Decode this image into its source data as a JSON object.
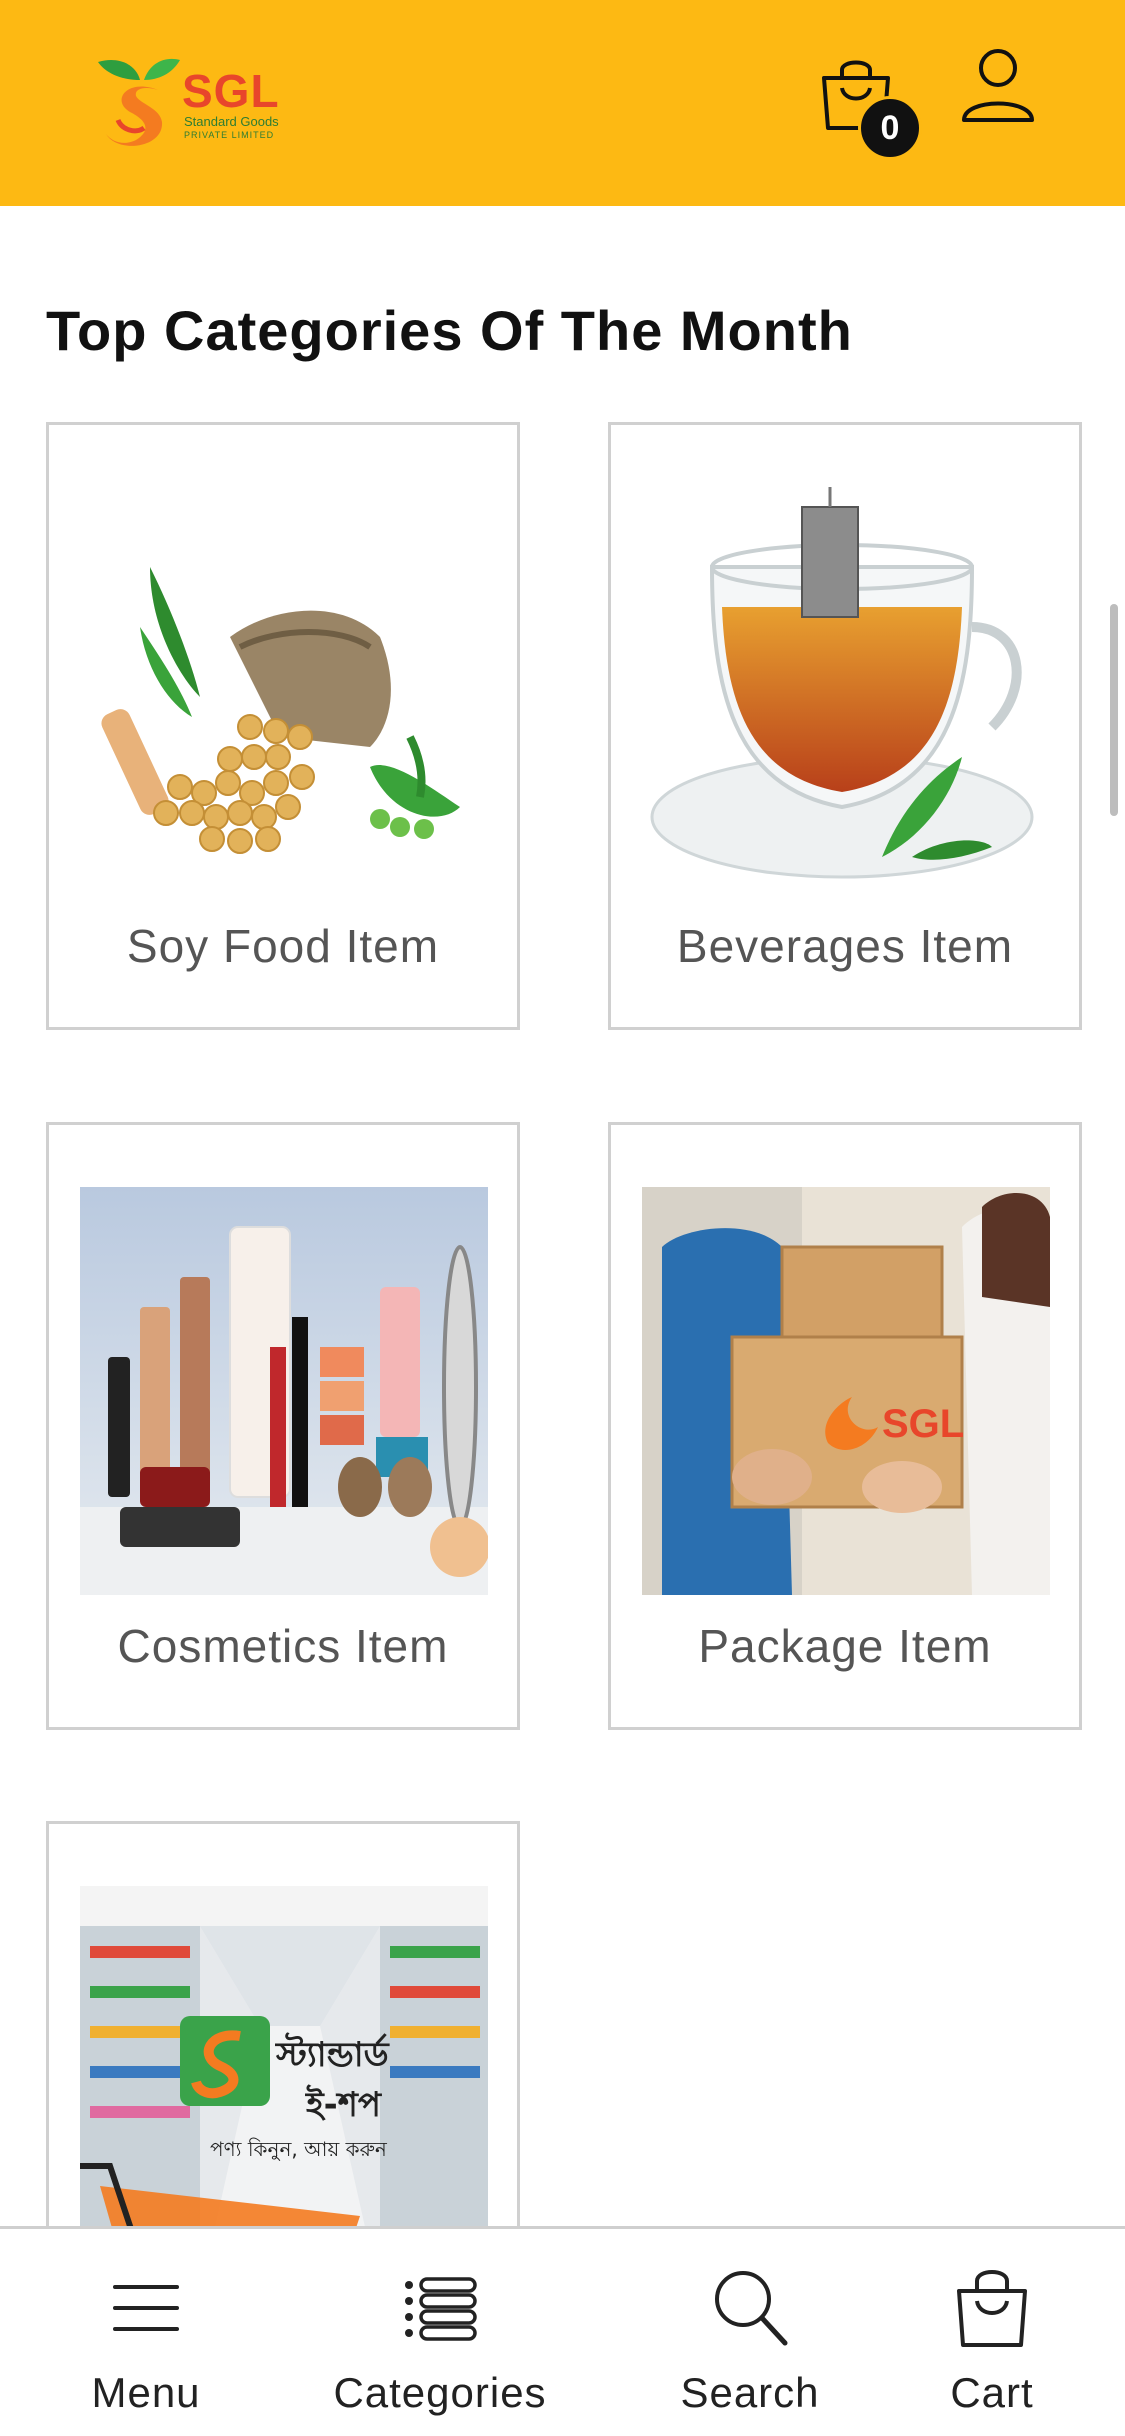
{
  "header": {
    "brand": "SGL",
    "brand_sub": "Standard Goods",
    "brand_tag": "PRIVATE LIMITED",
    "cart_count": "0",
    "bg_color": "#fdb913"
  },
  "section": {
    "title": "Top Categories Of The Month"
  },
  "categories": [
    {
      "label": "Soy Food Item",
      "icon": "soybean-sack-image"
    },
    {
      "label": "Beverages Item",
      "icon": "tea-cup-image"
    },
    {
      "label": "Cosmetics Item",
      "icon": "cosmetics-image"
    },
    {
      "label": "Package Item",
      "icon": "package-delivery-image"
    },
    {
      "label": "",
      "icon": "supermarket-eshop-image",
      "banner_text_1": "স্ট্যান্ডার্ড",
      "banner_text_2": "ই-শপ",
      "banner_text_3": "পণ্য কিনুন, আয় করুন"
    }
  ],
  "bottom_nav": {
    "items": [
      {
        "label": "Menu",
        "icon": "hamburger-menu-icon"
      },
      {
        "label": "Categories",
        "icon": "list-icon"
      },
      {
        "label": "Search",
        "icon": "search-icon"
      },
      {
        "label": "Cart",
        "icon": "shopping-bag-icon"
      }
    ]
  }
}
